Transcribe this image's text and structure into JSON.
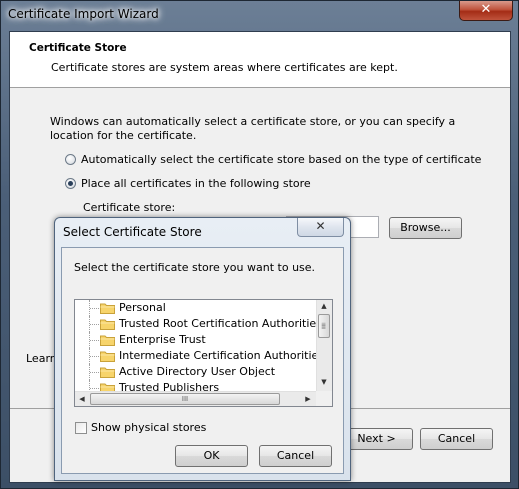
{
  "wizard": {
    "title": "Certificate Import Wizard",
    "close_glyph": "✕",
    "header_title": "Certificate Store",
    "header_subtitle": "Certificate stores are system areas where certificates are kept.",
    "description": "Windows can automatically select a certificate store, or you can specify a location for the certificate.",
    "radio_auto": "Automatically select the certificate store based on the type of certificate",
    "radio_place": "Place all certificates in the following store",
    "selected_radio": "place",
    "store_label": "Certificate store:",
    "store_value": "",
    "browse_button": "Browse...",
    "learn_more": "Learn",
    "next_button": "Next >",
    "cancel_button": "Cancel"
  },
  "dialog": {
    "title": "Select Certificate Store",
    "close_glyph": "✕",
    "prompt": "Select the certificate store you want to use.",
    "stores": [
      "Personal",
      "Trusted Root Certification Authorities",
      "Enterprise Trust",
      "Intermediate Certification Authorities",
      "Active Directory User Object",
      "Trusted Publishers"
    ],
    "show_physical_label": "Show physical stores",
    "show_physical_checked": false,
    "ok_button": "OK",
    "cancel_button": "Cancel",
    "scroll_grip": "III"
  },
  "icons": {
    "folder": "folder-icon",
    "close": "close-icon"
  },
  "colors": {
    "folder_fill": "#f7d46b",
    "folder_edge": "#c9a23a",
    "title_bar": "#4b5f78",
    "close_red": "#c0533c"
  }
}
